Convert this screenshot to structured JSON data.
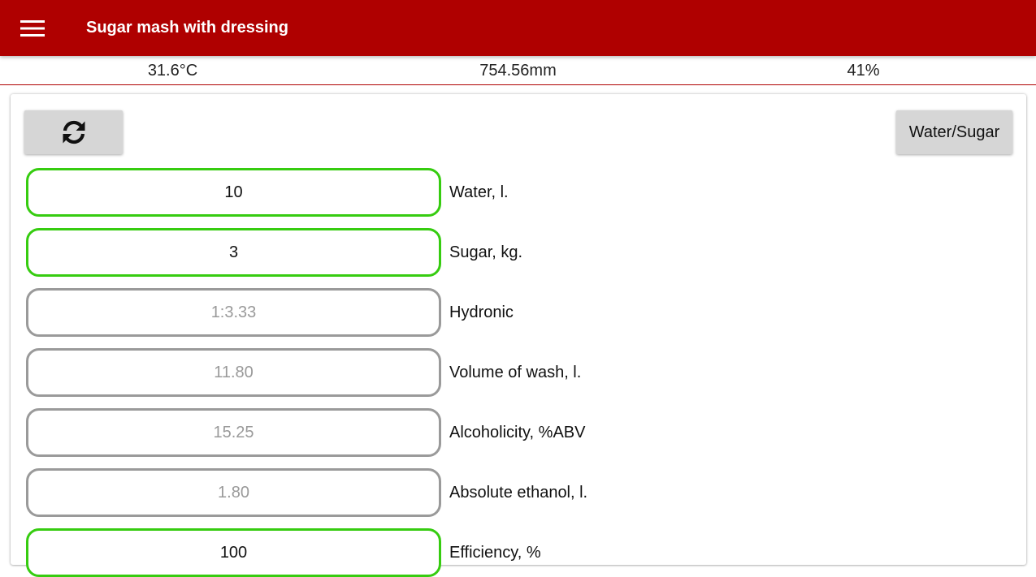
{
  "appbar": {
    "title": "Sugar mash with dressing",
    "bg_color": "#af0000",
    "menu_icon": "hamburger-menu-icon"
  },
  "status": {
    "temperature": "31.6°C",
    "pressure": "754.56mm",
    "humidity": "41%"
  },
  "toolbar": {
    "refresh_icon": "refresh-icon",
    "mode_button_label": "Water/Sugar"
  },
  "fields": [
    {
      "value": "10",
      "label": "Water, l.",
      "editable": true
    },
    {
      "value": "3",
      "label": "Sugar, kg.",
      "editable": true
    },
    {
      "value": "1:3.33",
      "label": "Hydronic",
      "editable": false
    },
    {
      "value": "11.80",
      "label": "Volume of wash, l.",
      "editable": false
    },
    {
      "value": "15.25",
      "label": "Alcoholicity, %ABV",
      "editable": false
    },
    {
      "value": "1.80",
      "label": "Absolute ethanol, l.",
      "editable": false
    },
    {
      "value": "100",
      "label": "Efficiency, %",
      "editable": true
    }
  ],
  "colors": {
    "editable_border": "#36cc10",
    "readonly_border": "#9a9a9a",
    "readonly_text": "#9a9a9a"
  }
}
